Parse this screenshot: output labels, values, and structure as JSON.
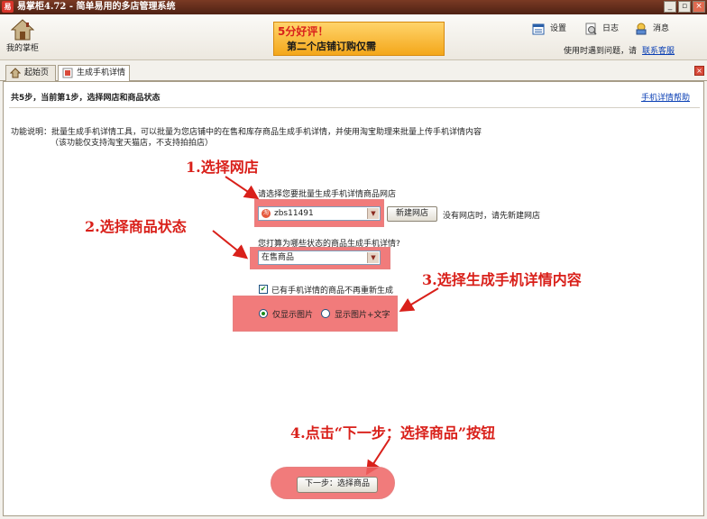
{
  "window": {
    "title": "易掌柜4.72 - 简单易用的多店管理系统",
    "app_icon": "易",
    "minimize": "_",
    "restore": "▫",
    "close": "×"
  },
  "toolbar": {
    "home_label": "我的掌柜",
    "banner_line1": "5分好评！",
    "banner_line2": "第二个店铺订购仅需",
    "settings": "设置",
    "log": "日志",
    "message": "消息",
    "help_text": "使用时遇到问题，请",
    "help_link": "联系客服"
  },
  "tabs": [
    {
      "label": "起始页"
    },
    {
      "label": "生成手机详情"
    }
  ],
  "tab_close": "×",
  "content": {
    "step_header": "共5步，当前第1步，选择网店和商品状态",
    "help_link": "手机详情帮助",
    "desc_line1": "功能说明：批量生成手机详情工具，可以批量为您店铺中的在售和库存商品生成手机详情，并使用淘宝助理来批量上传手机详情内容",
    "desc_line2": "（该功能仅支持淘宝天猫店，不支持拍拍店）",
    "shop_question": "请选择您要批量生成手机详情商品网店",
    "shop_value": "zbs11491",
    "new_shop_button": "新建网店",
    "no_shop_note": "没有网店时，请先新建网店",
    "status_question": "您打算为哪些状态的商品生成手机详情?",
    "status_value": "在售商品",
    "skip_existing_label": "已有手机详情的商品不再重新生成",
    "skip_existing_checked": true,
    "option_images_only": "仅显示图片",
    "option_images_text": "显示图片+文字",
    "selected_option": "images_only",
    "next_button": "下一步：选择商品"
  },
  "annotations": {
    "step1": "1.选择网店",
    "step2": "2.选择商品状态",
    "step3": "3.选择生成手机详情内容",
    "step4": "4.点击“下一步：选择商品”按钮"
  },
  "colors": {
    "accent_red": "#d9201a",
    "highlight": "#ee6464",
    "titlebar": "#5a2818",
    "link": "#0a3fb4"
  }
}
